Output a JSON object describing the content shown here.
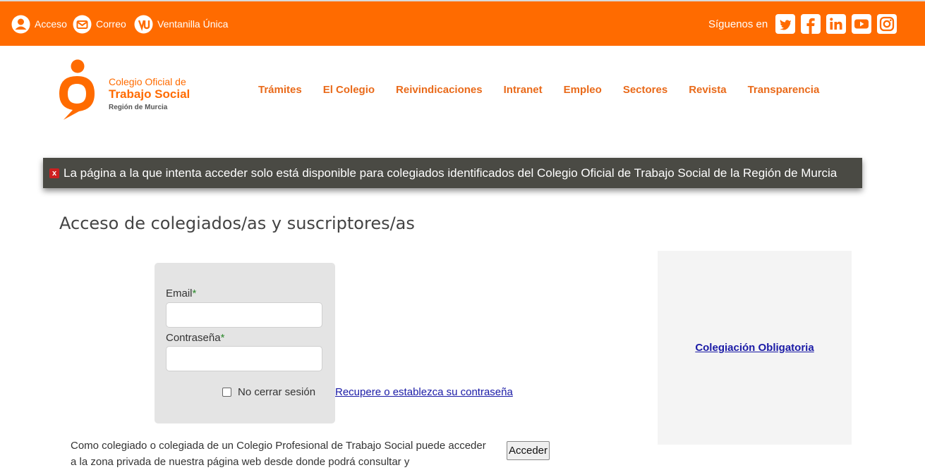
{
  "topbar": {
    "items": [
      {
        "label": "Acceso",
        "icon": "user-icon"
      },
      {
        "label": "Correo",
        "icon": "mail-icon"
      },
      {
        "label": "Ventanilla Única",
        "icon": "ventanilla-icon"
      }
    ],
    "follow_label": "Síguenos en",
    "social": [
      "twitter-icon",
      "facebook-icon",
      "linkedin-icon",
      "youtube-icon",
      "instagram-icon"
    ]
  },
  "logo": {
    "line1": "Colegio Oficial de",
    "line2": "Trabajo Social",
    "line3": "Región de Murcia"
  },
  "nav": {
    "items": [
      "Trámites",
      "El Colegio",
      "Reivindicaciones",
      "Intranet",
      "Empleo",
      "Sectores",
      "Revista",
      "Transparencia"
    ]
  },
  "alert": {
    "icon": "x",
    "message": "La página a la que intenta acceder solo está disponible para colegiados identificados del Colegio Oficial de Trabajo Social de la Región de Murcia"
  },
  "page": {
    "title": "Acceso de colegiados/as y suscriptores/as"
  },
  "login": {
    "email_label": "Email",
    "password_label": "Contraseña",
    "required_mark": "*",
    "remember_label": "No cerrar sesión",
    "recover_link": "Recupere o establezca su contraseña",
    "submit_label": "Acceder",
    "intro_text": "Como colegiado o colegiada de un Colegio Profesional de Trabajo Social puede acceder a la zona privada de nuestra página web desde donde podrá consultar y"
  },
  "sidebar": {
    "link": "Colegiación Obligatoria"
  },
  "colors": {
    "brand_orange": "#ff6b00",
    "alert_bg": "#4a4a44"
  }
}
